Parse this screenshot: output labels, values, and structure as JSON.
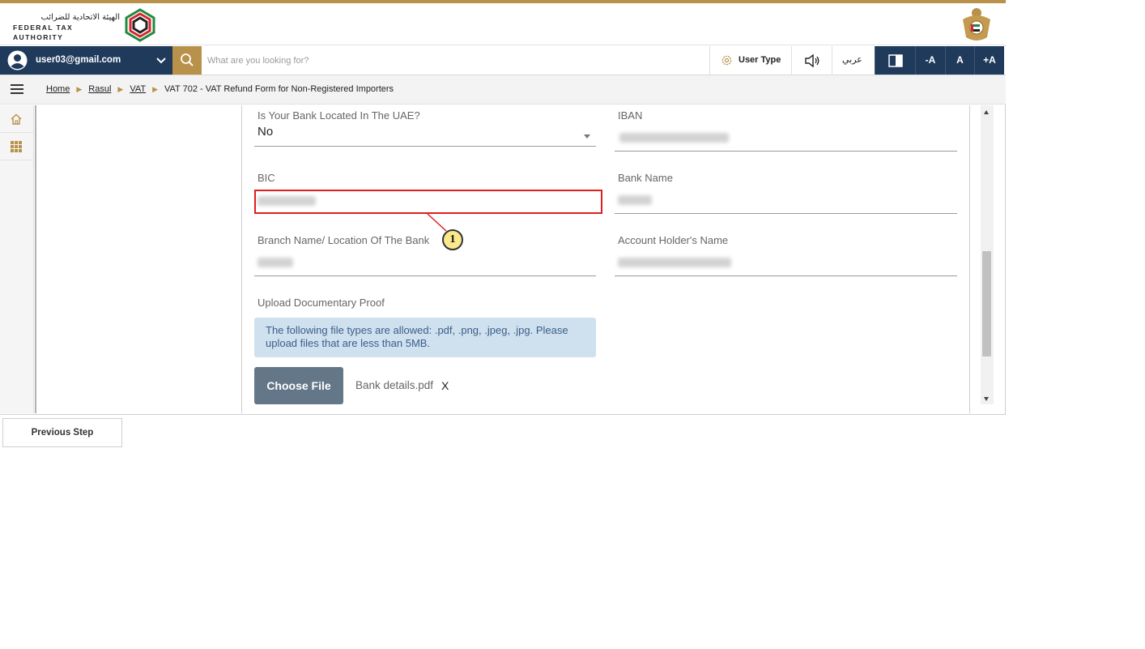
{
  "brand": {
    "name_ar": "الهيئة الاتحادية للضرائب",
    "name_en": "FEDERAL TAX AUTHORITY",
    "colors": {
      "gold": "#b8914a",
      "navy": "#203a5c"
    }
  },
  "navbar": {
    "user_email": "user03@gmail.com",
    "search_placeholder": "What are you looking for?",
    "user_type_label": "User Type",
    "language_label": "عربي",
    "font_decrease": "-A",
    "font_normal": "A",
    "font_increase": "+A"
  },
  "breadcrumb": {
    "items": [
      "Home",
      "Rasul",
      "VAT"
    ],
    "current": "VAT 702 - VAT Refund Form for Non-Registered Importers"
  },
  "form": {
    "bank_in_uae": {
      "label": "Is Your Bank Located In The UAE?",
      "value": "No"
    },
    "iban": {
      "label": "IBAN"
    },
    "bic": {
      "label": "BIC"
    },
    "bank_name": {
      "label": "Bank Name"
    },
    "branch": {
      "label": "Branch Name/ Location Of The Bank"
    },
    "account_holder": {
      "label": "Account Holder's Name"
    },
    "upload": {
      "label": "Upload Documentary Proof",
      "info": "The following file types are allowed: .pdf, .png, .jpeg, .jpg. Please upload files that are less than 5MB.",
      "button": "Choose File",
      "file_name": "Bank details.pdf",
      "remove": "X"
    }
  },
  "annotation": {
    "callout_number": "1",
    "color": "#e01e1e"
  },
  "footer": {
    "previous_step": "Previous Step"
  }
}
